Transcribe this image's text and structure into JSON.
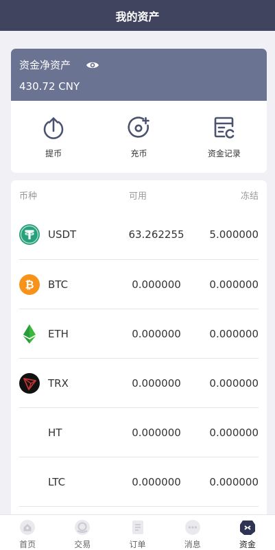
{
  "header": {
    "title": "我的资产"
  },
  "asset": {
    "label": "资金净资产",
    "amount": "430.72 CNY"
  },
  "actions": [
    {
      "label": "提币",
      "icon": "withdraw-icon"
    },
    {
      "label": "充币",
      "icon": "deposit-icon"
    },
    {
      "label": "资金记录",
      "icon": "records-icon"
    }
  ],
  "list": {
    "headers": {
      "coin": "币种",
      "available": "可用",
      "frozen": "冻结"
    },
    "rows": [
      {
        "coin": "USDT",
        "available": "63.262255",
        "frozen": "5.000000",
        "icon": "usdt-icon",
        "color": "#26a17b"
      },
      {
        "coin": "BTC",
        "available": "0.000000",
        "frozen": "0.000000",
        "icon": "btc-icon",
        "color": "#f7931a"
      },
      {
        "coin": "ETH",
        "available": "0.000000",
        "frozen": "0.000000",
        "icon": "eth-icon",
        "color": "#3ab83a"
      },
      {
        "coin": "TRX",
        "available": "0.000000",
        "frozen": "0.000000",
        "icon": "trx-icon",
        "color": "#c23631"
      },
      {
        "coin": "HT",
        "available": "0.000000",
        "frozen": "0.000000",
        "icon": "",
        "color": ""
      },
      {
        "coin": "LTC",
        "available": "0.000000",
        "frozen": "0.000000",
        "icon": "",
        "color": ""
      }
    ]
  },
  "tabbar": [
    {
      "label": "首页",
      "icon": "home-icon"
    },
    {
      "label": "交易",
      "icon": "trade-icon"
    },
    {
      "label": "订单",
      "icon": "order-icon"
    },
    {
      "label": "消息",
      "icon": "message-icon"
    },
    {
      "label": "资金",
      "icon": "assets-icon",
      "active": true
    }
  ],
  "colors": {
    "header": "#41445e",
    "asset_card": "#6b7393",
    "icon_stroke": "#4b5270"
  }
}
